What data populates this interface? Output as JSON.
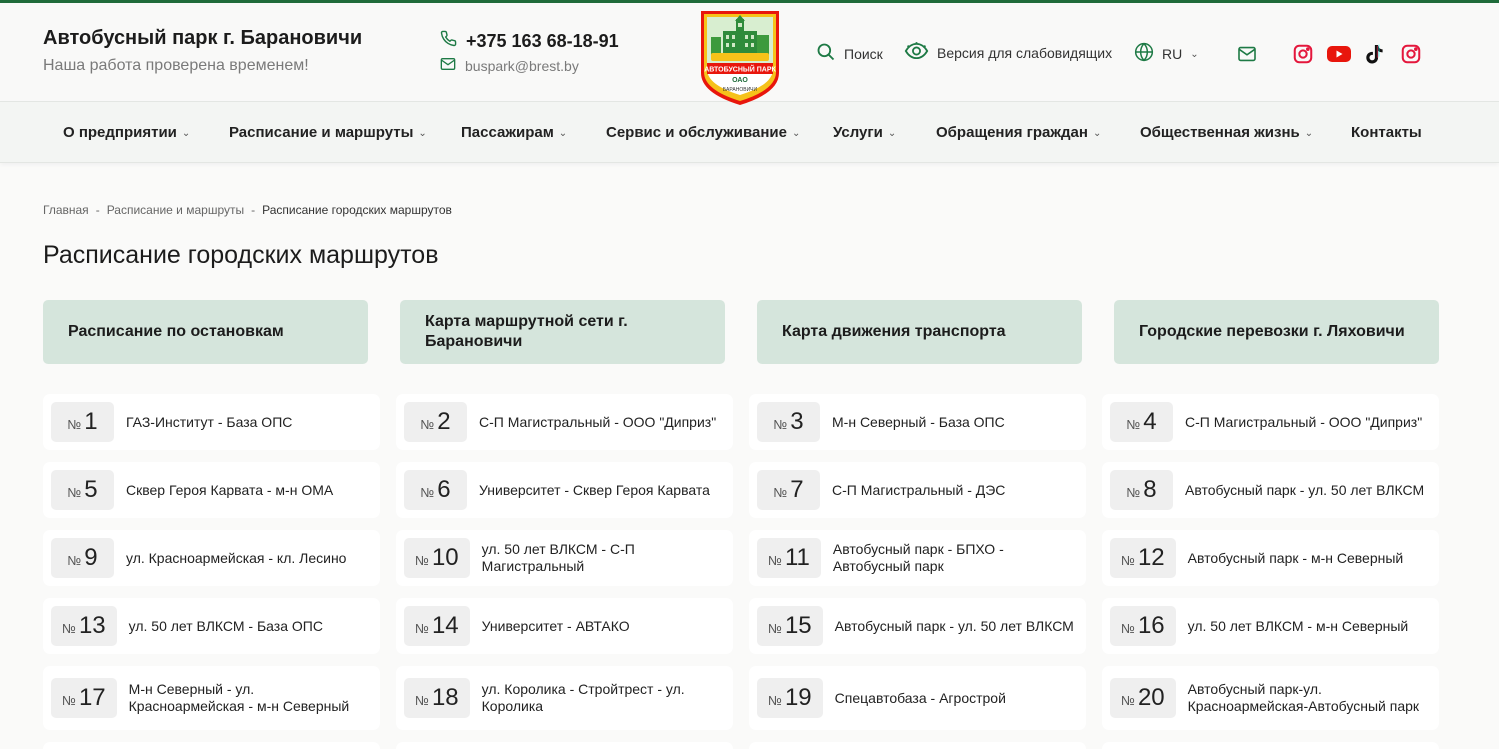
{
  "header": {
    "title": "Автобусный парк г. Барановичи",
    "subtitle": "Наша работа проверена временем!",
    "phone": "+375 163 68-18-91",
    "email": "buspark@brest.by",
    "logo_text_1": "АВТОБУСНЫЙ ПАРК",
    "logo_text_2": "ОАО",
    "logo_text_3": "БАРАНОВИЧИ",
    "search_label": "Поиск",
    "accessibility_label": "Версия для слабовидящих",
    "lang_label": "RU"
  },
  "nav": {
    "items": [
      {
        "label": "О предприятии",
        "dropdown": true
      },
      {
        "label": "Расписание и маршруты",
        "dropdown": true
      },
      {
        "label": "Пассажирам",
        "dropdown": true
      },
      {
        "label": "Сервис и обслуживание",
        "dropdown": true
      },
      {
        "label": "Услуги",
        "dropdown": true
      },
      {
        "label": "Обращения граждан",
        "dropdown": true
      },
      {
        "label": "Общественная жизнь",
        "dropdown": true
      },
      {
        "label": "Контакты",
        "dropdown": false
      }
    ]
  },
  "breadcrumb": {
    "home": "Главная",
    "section": "Расписание и маршруты",
    "current": "Расписание городских маршрутов",
    "separator": "-"
  },
  "page": {
    "title": "Расписание городских маршрутов"
  },
  "categories": [
    {
      "label": "Расписание по остановкам"
    },
    {
      "label": "Карта маршрутной сети г. Барановичи"
    },
    {
      "label": "Карта движения транспорта"
    },
    {
      "label": "Городские перевозки г. Ляховичи"
    }
  ],
  "routes": {
    "number_sign": "№",
    "items": [
      {
        "number": "1",
        "name": "ГАЗ-Институт - База ОПС"
      },
      {
        "number": "2",
        "name": "С-П Магистральный - ООО \"Диприз\""
      },
      {
        "number": "3",
        "name": "М-н Северный - База ОПС"
      },
      {
        "number": "4",
        "name": "С-П Магистральный - ООО \"Диприз\""
      },
      {
        "number": "5",
        "name": "Сквер Героя Карвата - м-н ОМА"
      },
      {
        "number": "6",
        "name": "Университет - Сквер Героя Карвата"
      },
      {
        "number": "7",
        "name": "С-П Магистральный - ДЭС"
      },
      {
        "number": "8",
        "name": "Автобусный парк - ул. 50 лет ВЛКСМ"
      },
      {
        "number": "9",
        "name": "ул. Красноармейская - кл. Лесино"
      },
      {
        "number": "10",
        "name": "ул. 50 лет ВЛКСМ - С-П Магистральный"
      },
      {
        "number": "11",
        "name": "Автобусный парк - БПХО - Автобусный парк"
      },
      {
        "number": "12",
        "name": "Автобусный парк - м-н Северный"
      },
      {
        "number": "13",
        "name": "ул. 50 лет ВЛКСМ - База ОПС"
      },
      {
        "number": "14",
        "name": "Университет - АВТАКО"
      },
      {
        "number": "15",
        "name": "Автобусный парк - ул. 50 лет ВЛКСМ"
      },
      {
        "number": "16",
        "name": "ул. 50 лет ВЛКСМ - м-н Северный"
      },
      {
        "number": "17",
        "name": "М-н Северный - ул. Красноармейская - м-н Северный"
      },
      {
        "number": "18",
        "name": "ул. Королика - Стройтрест - ул. Королика"
      },
      {
        "number": "19",
        "name": "Спецавтобаза - Агрострой"
      },
      {
        "number": "20",
        "name": "Автобусный парк-ул. Красноармейская-Автобусный парк"
      }
    ]
  },
  "colors": {
    "brand_green": "#1f6b3a",
    "category_bg": "#d5e5dc",
    "icon_green": "#1e7a45",
    "social_red": "#e4173c"
  },
  "icons": [
    "phone-icon",
    "mail-icon",
    "search-icon",
    "eye-icon",
    "globe-icon",
    "chevron-down-icon",
    "envelope-icon",
    "instagram-icon",
    "youtube-icon",
    "tiktok-icon"
  ]
}
